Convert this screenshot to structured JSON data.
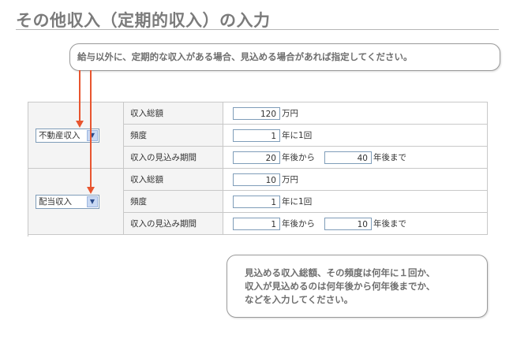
{
  "title": "その他収入（定期的収入）の入力",
  "callouts": {
    "top": "給与以外に、定期的な収入がある場合、見込める場合があれば指定してください。",
    "bottom_lines": [
      "見込める収入総額、その頻度は何年に１回か、",
      "収入が見込めるのは何年後から何年後までか、",
      "などを入力してください。"
    ]
  },
  "labels": {
    "total": "収入総額",
    "frequency": "頻度",
    "period": "収入の見込み期間",
    "unit_man_yen": "万円",
    "freq_prefix": "年に",
    "freq_suffix": "回",
    "years_from": "年後から",
    "years_to": "年後まで"
  },
  "incomes": [
    {
      "type": "不動産収入",
      "total": "120",
      "frequency_years": "1",
      "freq_count": "1",
      "start_year": "20",
      "end_year": "40"
    },
    {
      "type": "配当収入",
      "total": "10",
      "frequency_years": "1",
      "freq_count": "1",
      "start_year": "1",
      "end_year": "10"
    }
  ],
  "colors": {
    "arrow": "#e8552f",
    "title": "#7b7b7b",
    "input_border": "#7f9db9"
  },
  "icons": {
    "dropdown": "chevron-down-icon"
  }
}
